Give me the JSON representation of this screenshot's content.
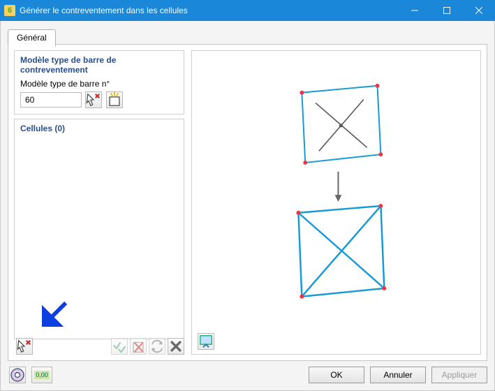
{
  "window": {
    "title": "Générer le contreventement dans les cellules"
  },
  "tabs": {
    "general": "Général"
  },
  "model_group": {
    "title": "Modèle type de barre de contreventement",
    "label": "Modèle type de barre n°",
    "value": "60"
  },
  "cells_group": {
    "title": "Cellules (0)"
  },
  "icons": {
    "pick": "select-pick-icon",
    "new": "new-item-icon",
    "check": "multi-check-icon",
    "delete": "delete-icon",
    "swap": "swap-icon",
    "remove": "remove-x-icon",
    "preview_mode": "preview-toggle-icon",
    "help": "help-icon",
    "units": "units-icon"
  },
  "units_icon_text": "0,00",
  "buttons": {
    "ok": "OK",
    "cancel": "Annuler",
    "apply": "Appliquer"
  }
}
